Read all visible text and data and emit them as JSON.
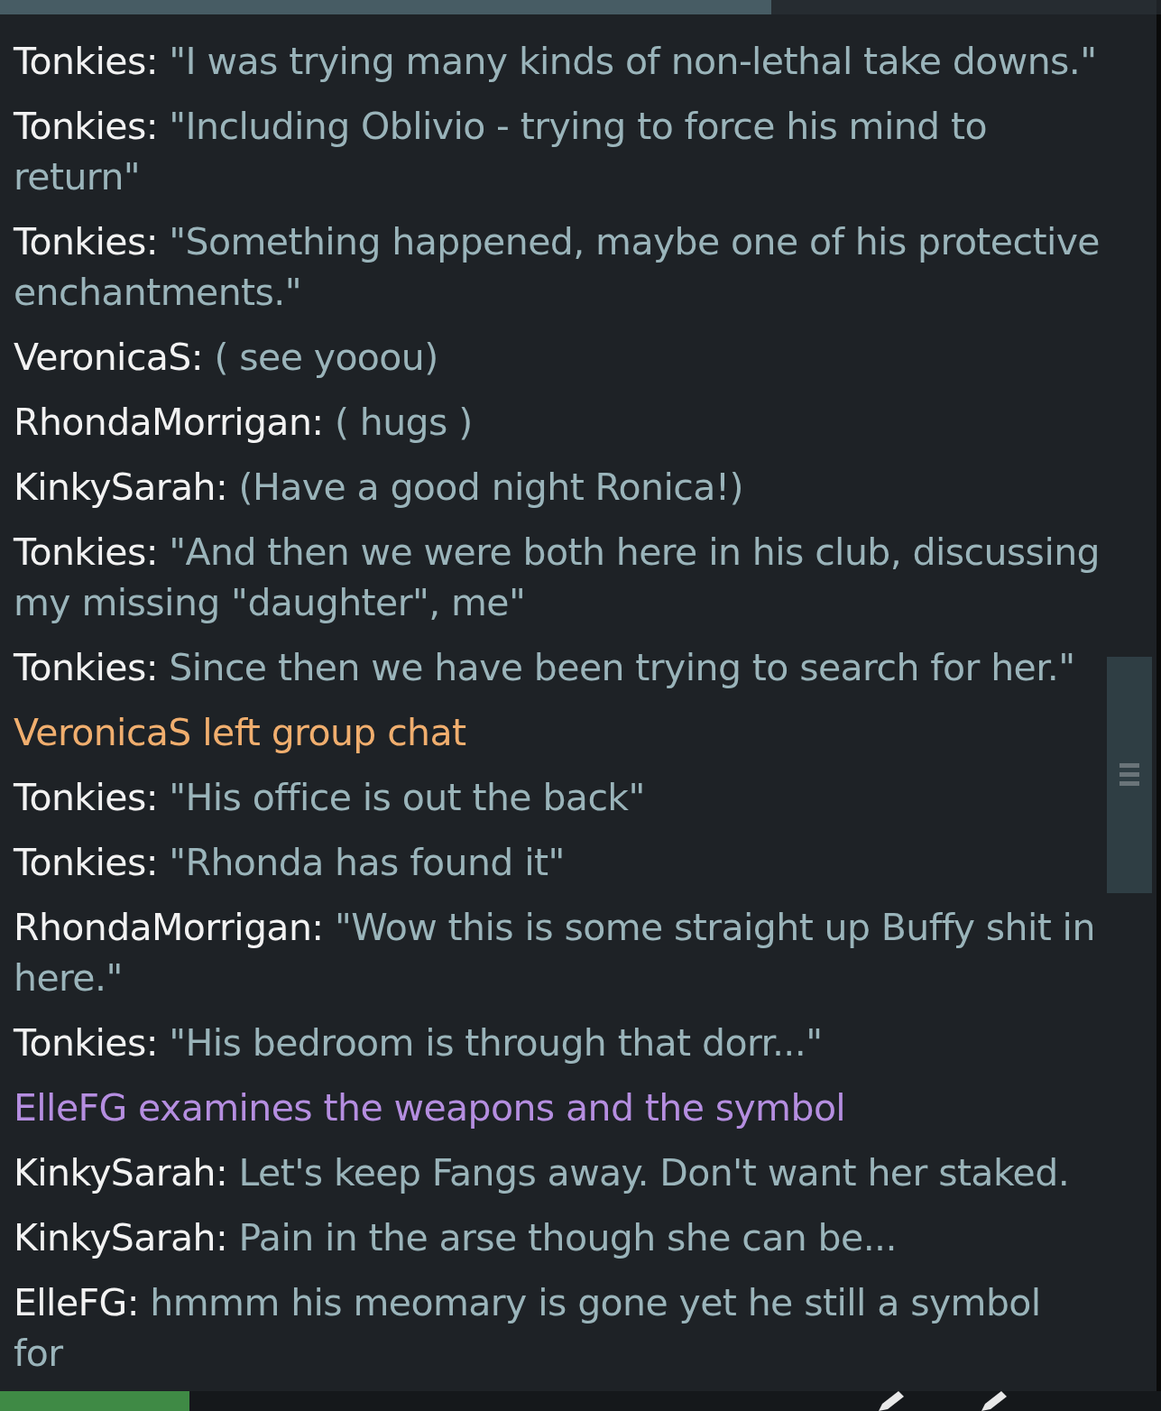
{
  "tabs": [
    {
      "selected": false
    },
    {
      "selected": false
    },
    {
      "selected": true
    }
  ],
  "messages": [
    {
      "kind": "say",
      "name": "Tonkies:",
      "text": "\"I was trying many kinds of non-lethal take downs.\""
    },
    {
      "kind": "say",
      "name": "Tonkies:",
      "text": "\"Including Oblivio - trying to force his mind to return\""
    },
    {
      "kind": "say",
      "name": "Tonkies:",
      "text": "\"Something happened, maybe one of his protective enchantments.\""
    },
    {
      "kind": "say",
      "name": "VeronicaS:",
      "text": "( see yooou)"
    },
    {
      "kind": "say",
      "name": "RhondaMorrigan:",
      "text": "( hugs )"
    },
    {
      "kind": "say",
      "name": "KinkySarah:",
      "text": "(Have a good night Ronica!)"
    },
    {
      "kind": "say",
      "name": "Tonkies:",
      "text": "\"And then we were both here in his club, discussing my missing \"daughter\", me\""
    },
    {
      "kind": "say",
      "name": "Tonkies:",
      "text": "Since then we have been trying to search for her.\""
    },
    {
      "kind": "system",
      "text": "VeronicaS left group chat",
      "color": "#f0ae6e"
    },
    {
      "kind": "say",
      "name": "Tonkies:",
      "text": "\"His office is out the back\""
    },
    {
      "kind": "say",
      "name": "Tonkies:",
      "text": "\"Rhonda has found it\""
    },
    {
      "kind": "say",
      "name": "RhondaMorrigan:",
      "text": "\"Wow this is some straight up Buffy shit in here.\""
    },
    {
      "kind": "say",
      "name": "Tonkies:",
      "text": "\"His bedroom is through that dorr...\""
    },
    {
      "kind": "system",
      "text": "ElleFG examines the weapons and the symbol",
      "color": "#b58ee0"
    },
    {
      "kind": "say",
      "name": "KinkySarah:",
      "text": "Let's keep Fangs away. Don't want her staked."
    },
    {
      "kind": "say",
      "name": "KinkySarah:",
      "text": "Pain in the arse though she can be..."
    },
    {
      "kind": "say",
      "name": "ElleFG:",
      "text": "hmmm his meomary is gone yet he still a symbol for"
    }
  ]
}
